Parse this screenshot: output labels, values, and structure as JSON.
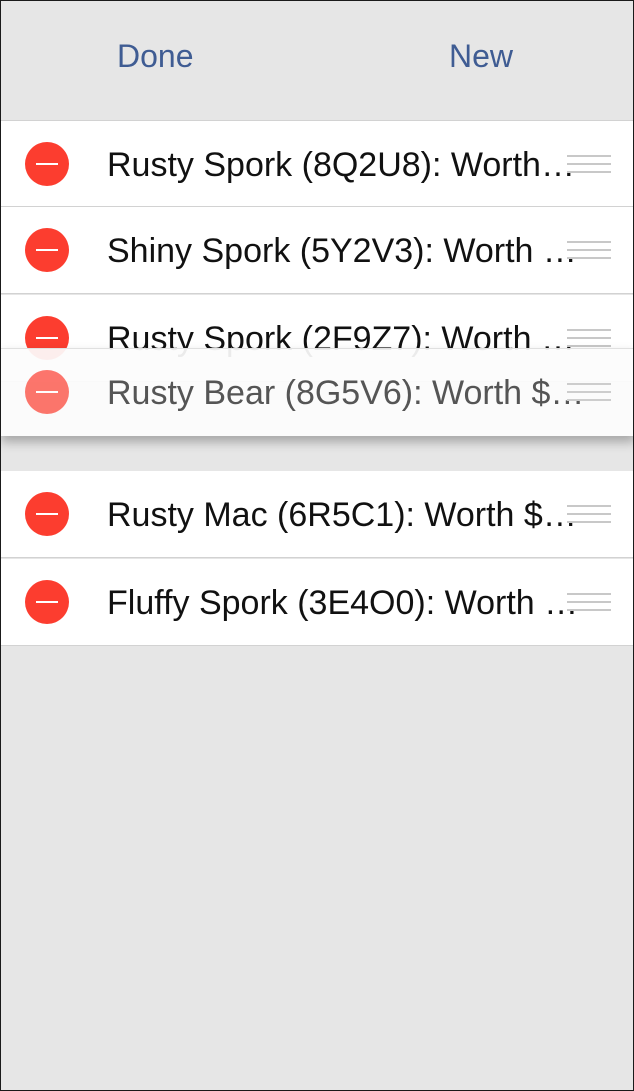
{
  "navbar": {
    "done_label": "Done",
    "new_label": "New"
  },
  "items": [
    {
      "label": "Rusty Spork (8Q2U8): Worth…"
    },
    {
      "label": "Shiny Spork (5Y2V3): Worth $…"
    },
    {
      "label": "Rusty Spork (2F9Z7): Worth $…"
    },
    {
      "label": "Rusty Mac (6R5C1): Worth $9…"
    },
    {
      "label": "Fluffy Spork (3E4O0): Worth $…"
    }
  ],
  "dragging_item": {
    "label": "Rusty Bear (8G5V6): Worth $…"
  },
  "colors": {
    "accent": "#3f5c93",
    "delete": "#fc3d2f",
    "background": "#e6e6e6"
  },
  "icons": {
    "delete": "minus-circle-icon",
    "reorder": "reorder-grip-icon"
  }
}
